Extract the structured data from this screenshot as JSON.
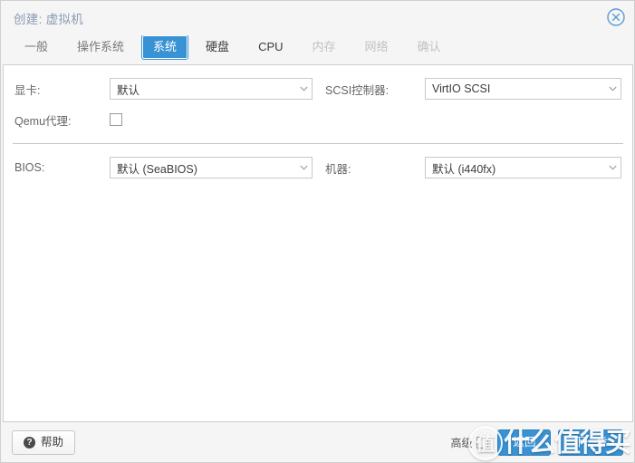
{
  "window": {
    "title": "创建: 虚拟机",
    "close_icon": "close-circle-icon"
  },
  "tabs": [
    {
      "label": "一般",
      "state": "enabled"
    },
    {
      "label": "操作系统",
      "state": "enabled"
    },
    {
      "label": "系统",
      "state": "active"
    },
    {
      "label": "硬盘",
      "state": "enabled"
    },
    {
      "label": "CPU",
      "state": "enabled"
    },
    {
      "label": "内存",
      "state": "disabled"
    },
    {
      "label": "网络",
      "state": "disabled"
    },
    {
      "label": "确认",
      "state": "disabled"
    }
  ],
  "form": {
    "section1": {
      "left": [
        {
          "label": "显卡:",
          "type": "select",
          "value": "默认"
        },
        {
          "label": "Qemu代理:",
          "type": "checkbox",
          "checked": false
        }
      ],
      "right": [
        {
          "label": "SCSI控制器:",
          "type": "select",
          "value": "VirtIO SCSI"
        }
      ]
    },
    "section2": {
      "left": [
        {
          "label": "BIOS:",
          "type": "select",
          "value": "默认 (SeaBIOS)"
        }
      ],
      "right": [
        {
          "label": "机器:",
          "type": "select",
          "value": "默认 (i440fx)"
        }
      ]
    }
  },
  "footer": {
    "help_label": "帮助",
    "help_icon": "question-mark-icon",
    "advanced_label": "高级",
    "advanced_checked": false,
    "back_label": "返回",
    "next_label": "下一步"
  },
  "watermark": {
    "badge": "值",
    "text": "什么值得买"
  },
  "colors": {
    "accent": "#3892d4",
    "title": "#8a9bb3",
    "text": "#3c3c3c",
    "label": "#666666",
    "disabled": "#c2c2c2",
    "border": "#c8c8c8",
    "window_bg": "#f5f5f5"
  }
}
